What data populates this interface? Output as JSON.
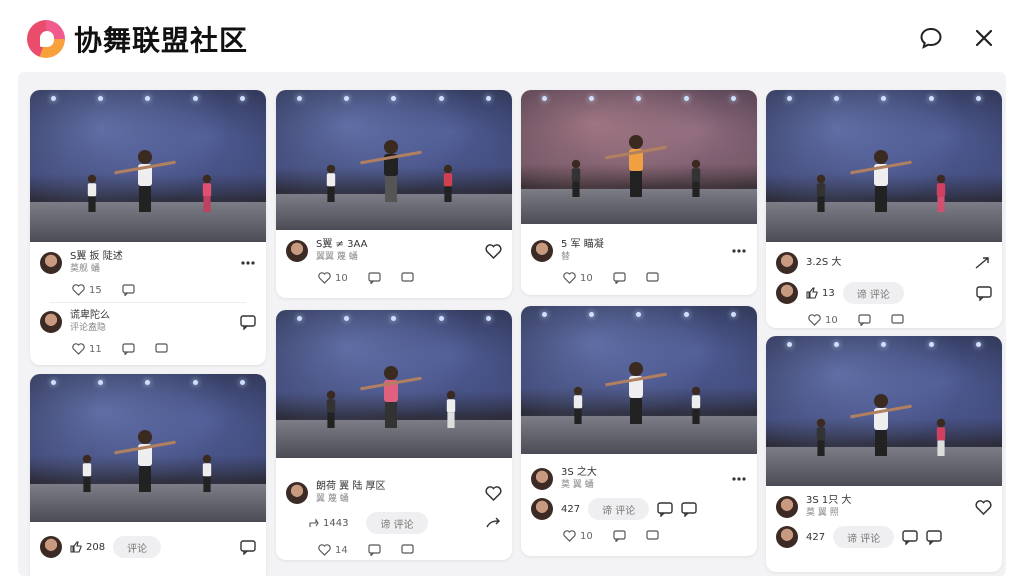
{
  "app": {
    "title": "协舞联盟社区"
  },
  "header": {
    "chat_icon": "speech-bubble-icon",
    "close_icon": "close-icon"
  },
  "cards": {
    "c1": {
      "user": "S翼 扳 陡述",
      "sub": "莫舰 蛹",
      "likes": "15"
    },
    "c1b": {
      "user": "谎卑陀么",
      "sub": "评论盍隐",
      "likes": "11"
    },
    "c2": {
      "user": "S翼 ≠ 3AA",
      "sub": "翼翼 蔑 蛹",
      "likes": "10"
    },
    "c3": {
      "user": "5 军 瞄凝",
      "sub": "替",
      "likes": "10"
    },
    "c4": {
      "user": "3.2S 大",
      "likes_inline": "13",
      "comment_placeholder": "谛 评论",
      "likes": "10"
    },
    "c5": {
      "likes": "208",
      "comment_placeholder": "评论"
    },
    "c6": {
      "user": "朗荷 翼 陆 厚区",
      "sub": "翼 蔑 蛹",
      "shares": "1443",
      "comment_placeholder": "谛 评论",
      "likes": "14"
    },
    "c7": {
      "user": "3S 之大",
      "sub": "莫 翼 蛹",
      "likes_inline": "427",
      "comment_placeholder": "谛 评论",
      "likes": "10"
    },
    "c8": {
      "user": "3S 1只 大",
      "sub": "莫 翼 照",
      "likes_inline": "427",
      "comment_placeholder": "谛 评论"
    }
  }
}
